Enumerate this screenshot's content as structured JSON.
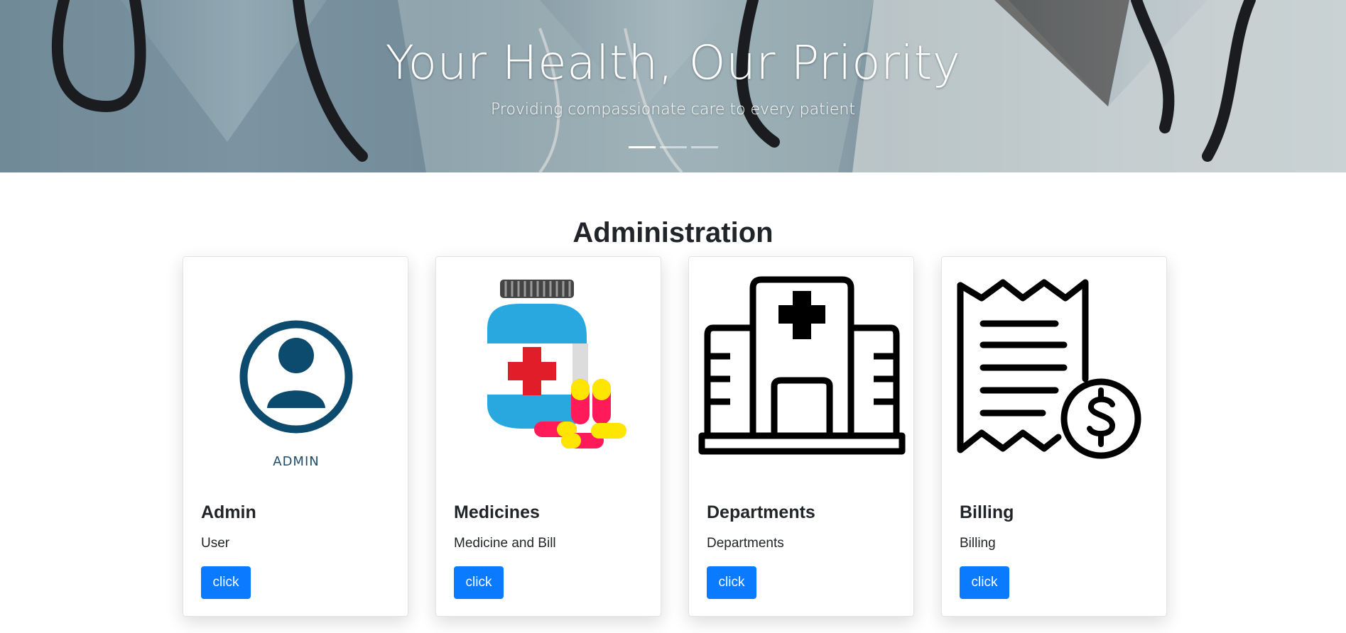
{
  "hero": {
    "title": "Your Health, Our Priority",
    "subtitle": "Providing compassionate care to every patient",
    "indicators": 3,
    "active_indicator": 0
  },
  "section": {
    "title": "Administration"
  },
  "cards": [
    {
      "icon": "admin-user-icon",
      "image_label": "ADMIN",
      "title": "Admin",
      "text": "User",
      "button": "click"
    },
    {
      "icon": "medicine-bottle-icon",
      "title": "Medicines",
      "text": "Medicine and Bill",
      "button": "click"
    },
    {
      "icon": "hospital-building-icon",
      "title": "Departments",
      "text": "Departments",
      "button": "click"
    },
    {
      "icon": "receipt-dollar-icon",
      "title": "Billing",
      "text": "Billing",
      "button": "click"
    }
  ],
  "colors": {
    "primary_button": "#0a7bff",
    "admin_icon": "#0c4a6e",
    "medicine_blue": "#29a8e0",
    "medicine_red": "#e11d2a",
    "pill_yellow": "#ffe600",
    "pill_pink": "#ff1a5a"
  }
}
